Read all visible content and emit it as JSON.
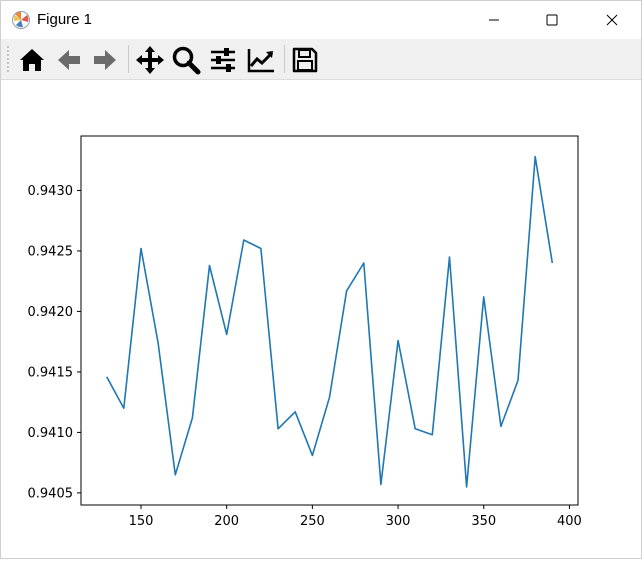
{
  "window": {
    "title": "Figure 1",
    "icons": {
      "app": "matplotlib-logo-icon",
      "minimize": "minimize-icon",
      "maximize": "maximize-icon",
      "close": "close-icon"
    }
  },
  "toolbar": {
    "tools": [
      {
        "name": "home",
        "icon": "home-icon"
      },
      {
        "name": "back",
        "icon": "arrow-left-icon"
      },
      {
        "name": "forward",
        "icon": "arrow-right-icon"
      },
      {
        "name": "pan",
        "icon": "move-icon"
      },
      {
        "name": "zoom",
        "icon": "magnifier-icon"
      },
      {
        "name": "subplots",
        "icon": "sliders-icon"
      },
      {
        "name": "customize",
        "icon": "chart-line-icon"
      },
      {
        "name": "save",
        "icon": "floppy-disk-icon"
      }
    ]
  },
  "chart_data": {
    "type": "line",
    "title": "",
    "xlabel": "",
    "ylabel": "",
    "xlim": [
      115,
      405
    ],
    "ylim": [
      0.9404,
      0.94345
    ],
    "xticks": [
      150,
      200,
      250,
      300,
      350,
      400
    ],
    "yticks": [
      0.9405,
      0.941,
      0.9415,
      0.942,
      0.9425,
      0.943
    ],
    "xtick_labels": [
      "150",
      "200",
      "250",
      "300",
      "350",
      "400"
    ],
    "ytick_labels": [
      "0.9405",
      "0.9410",
      "0.9415",
      "0.9420",
      "0.9425",
      "0.9430"
    ],
    "grid": false,
    "line_color": "#1f77b4",
    "x": [
      130,
      140,
      150,
      160,
      170,
      180,
      190,
      200,
      210,
      220,
      230,
      240,
      250,
      260,
      270,
      280,
      290,
      300,
      310,
      320,
      330,
      340,
      350,
      360,
      370,
      380,
      390
    ],
    "y": [
      0.94146,
      0.9412,
      0.94252,
      0.94174,
      0.94065,
      0.94112,
      0.94238,
      0.94181,
      0.94259,
      0.94252,
      0.94103,
      0.94117,
      0.94081,
      0.94129,
      0.94217,
      0.9424,
      0.94057,
      0.94176,
      0.94103,
      0.94098,
      0.94245,
      0.94055,
      0.94212,
      0.94105,
      0.94143,
      0.94328,
      0.9424
    ]
  }
}
